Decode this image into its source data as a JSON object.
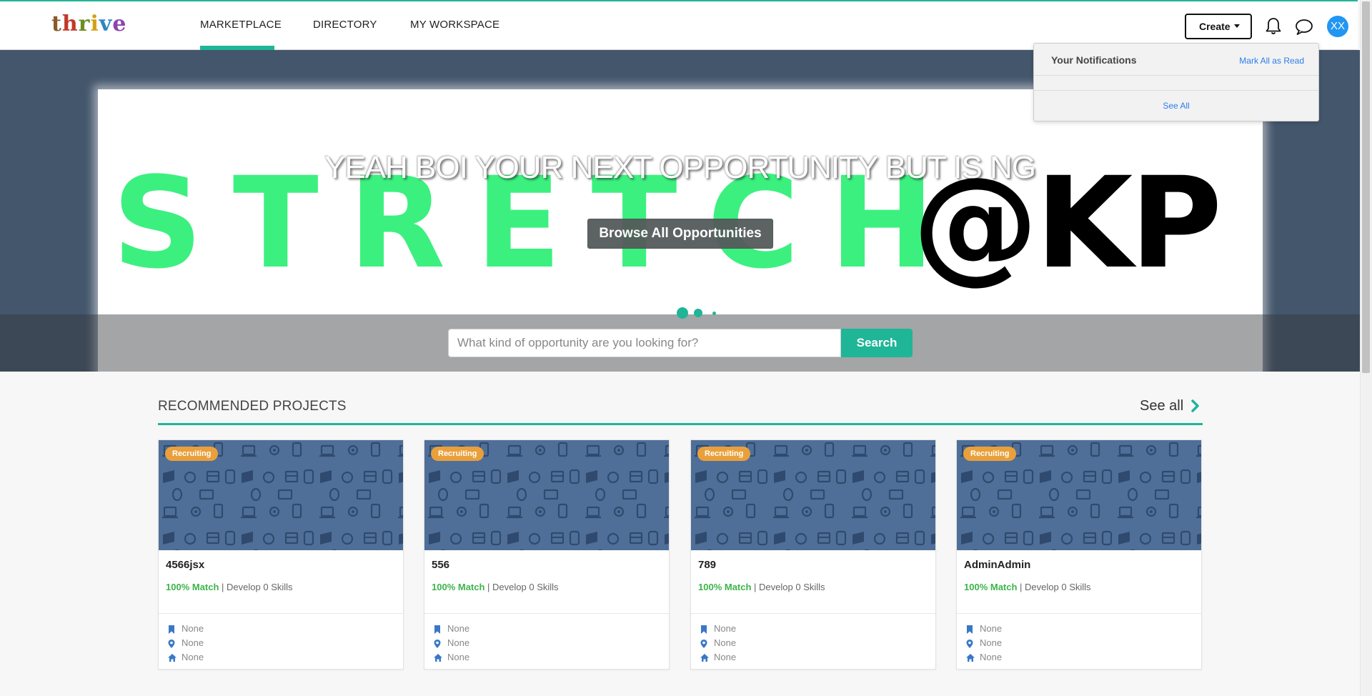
{
  "header": {
    "logo": "thrive",
    "nav": [
      {
        "label": "MARKETPLACE",
        "active": true
      },
      {
        "label": "DIRECTORY",
        "active": false
      },
      {
        "label": "MY WORKSPACE",
        "active": false
      }
    ],
    "create_label": "Create",
    "avatar_initials": "XX",
    "icons": [
      "bell-icon",
      "chat-icon"
    ],
    "accent_color": "#1fb597"
  },
  "hero": {
    "headline": "YEAH BOI YOUR NEXT OPPORTUNITY BUT IS NG",
    "banner_word": "STRETCH",
    "banner_handle": "@KP",
    "browse_label": "Browse All Opportunities",
    "search_placeholder": "What kind of opportunity are you looking for?",
    "search_label": "Search",
    "carousel_dots": 3
  },
  "notifications": {
    "title": "Your Notifications",
    "mark_all": "Mark All as Read",
    "see_all": "See All"
  },
  "recommended": {
    "title": "RECOMMENDED PROJECTS",
    "see_all": "See all",
    "cards": [
      {
        "badge": "Recruiting",
        "title": "4566jsx",
        "match": "100% Match",
        "develop": "Develop 0 Skills",
        "meta": [
          "None",
          "None",
          "None"
        ]
      },
      {
        "badge": "Recruiting",
        "title": "556",
        "match": "100% Match",
        "develop": "Develop 0 Skills",
        "meta": [
          "None",
          "None",
          "None"
        ]
      },
      {
        "badge": "Recruiting",
        "title": "789",
        "match": "100% Match",
        "develop": "Develop 0 Skills",
        "meta": [
          "None",
          "None",
          "None"
        ]
      },
      {
        "badge": "Recruiting",
        "title": "AdminAdmin",
        "match": "100% Match",
        "develop": "Develop 0 Skills",
        "meta": [
          "None",
          "None",
          "None"
        ]
      }
    ],
    "meta_icons": [
      "bookmark-icon",
      "location-pin-icon",
      "home-icon"
    ]
  }
}
